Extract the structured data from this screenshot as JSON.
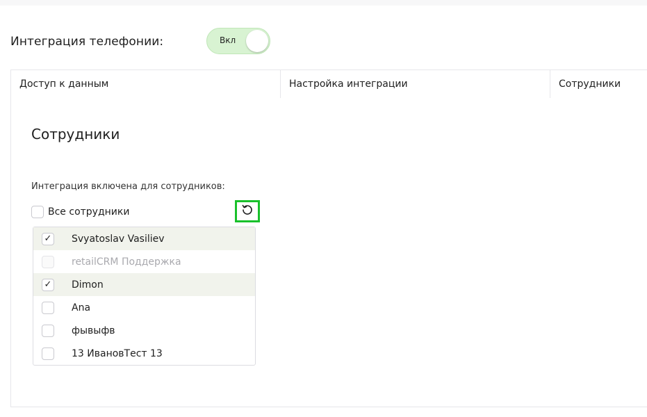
{
  "header": {
    "title": "Интеграция телефонии:",
    "toggle_label": "Вкл"
  },
  "tabs": [
    {
      "label": "Доступ к данным"
    },
    {
      "label": "Настройка интеграции"
    },
    {
      "label": "Сотрудники"
    }
  ],
  "employees_section": {
    "title": "Сотрудники",
    "field_label": "Интеграция включена для сотрудников:",
    "all_label": "Все сотрудники",
    "list": [
      {
        "name": "Svyatoslav Vasiliev",
        "checked": true,
        "disabled": false
      },
      {
        "name": "retailCRM Поддержка",
        "checked": false,
        "disabled": true
      },
      {
        "name": "Dimon",
        "checked": true,
        "disabled": false
      },
      {
        "name": "Ana",
        "checked": false,
        "disabled": false
      },
      {
        "name": "фывыфв",
        "checked": false,
        "disabled": false
      },
      {
        "name": "13 ИвановТест 13",
        "checked": false,
        "disabled": false
      }
    ]
  },
  "icons": {
    "refresh": "refresh-icon",
    "check": "check-icon"
  },
  "colors": {
    "toggle_bg": "#d8f3d2",
    "highlight": "#19c12b",
    "selected_row": "#f1f3ec"
  }
}
